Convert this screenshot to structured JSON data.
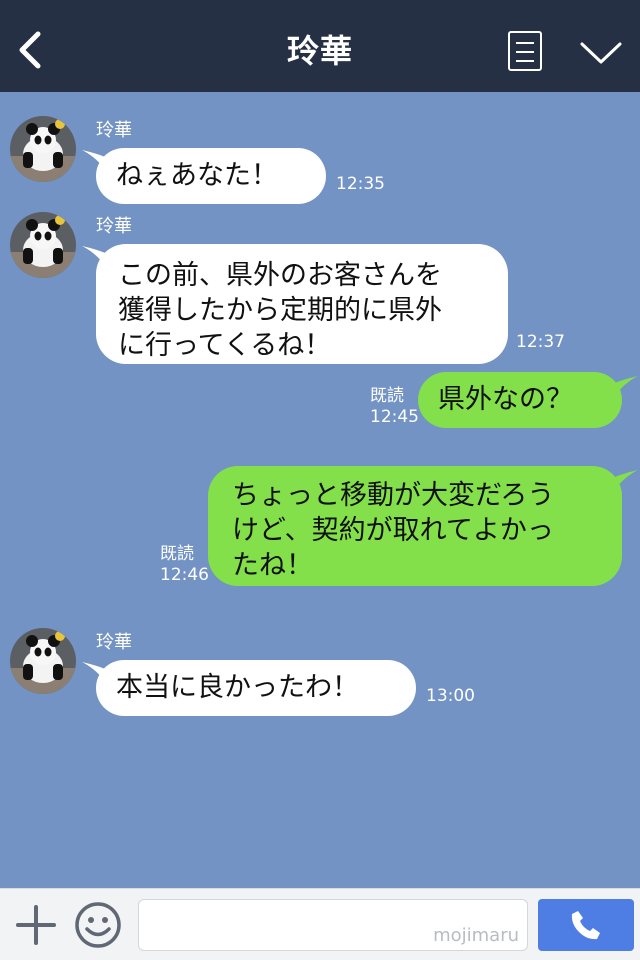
{
  "header": {
    "title": "玲華",
    "back_icon": "chevron-left-icon",
    "menu_icon": "note-icon",
    "collapse_icon": "chevron-down-icon"
  },
  "messages": [
    {
      "direction": "incoming",
      "sender": "玲華",
      "lines": [
        "ねぇあなた！"
      ],
      "time": "12:35"
    },
    {
      "direction": "incoming",
      "sender": "玲華",
      "lines": [
        "この前、県外のお客さんを",
        "獲得したから定期的に県外",
        "に行ってくるね！"
      ],
      "time": "12:37"
    },
    {
      "direction": "outgoing",
      "read": "既読",
      "lines": [
        "県外なの？"
      ],
      "time": "12:45"
    },
    {
      "direction": "outgoing",
      "read": "既読",
      "lines": [
        "ちょっと移動が大変だろう",
        "けど、契約が取れてよかっ",
        "たね！"
      ],
      "time": "12:46"
    },
    {
      "direction": "incoming",
      "sender": "玲華",
      "lines": [
        "本当に良かったわ！"
      ],
      "time": "13:00"
    }
  ],
  "input": {
    "value": "",
    "watermark": "mojimaru"
  },
  "colors": {
    "background": "#7293c4",
    "header": "#263044",
    "outgoing_bubble": "#84e04a",
    "incoming_bubble": "#ffffff",
    "call_button": "#4e7ee4"
  }
}
